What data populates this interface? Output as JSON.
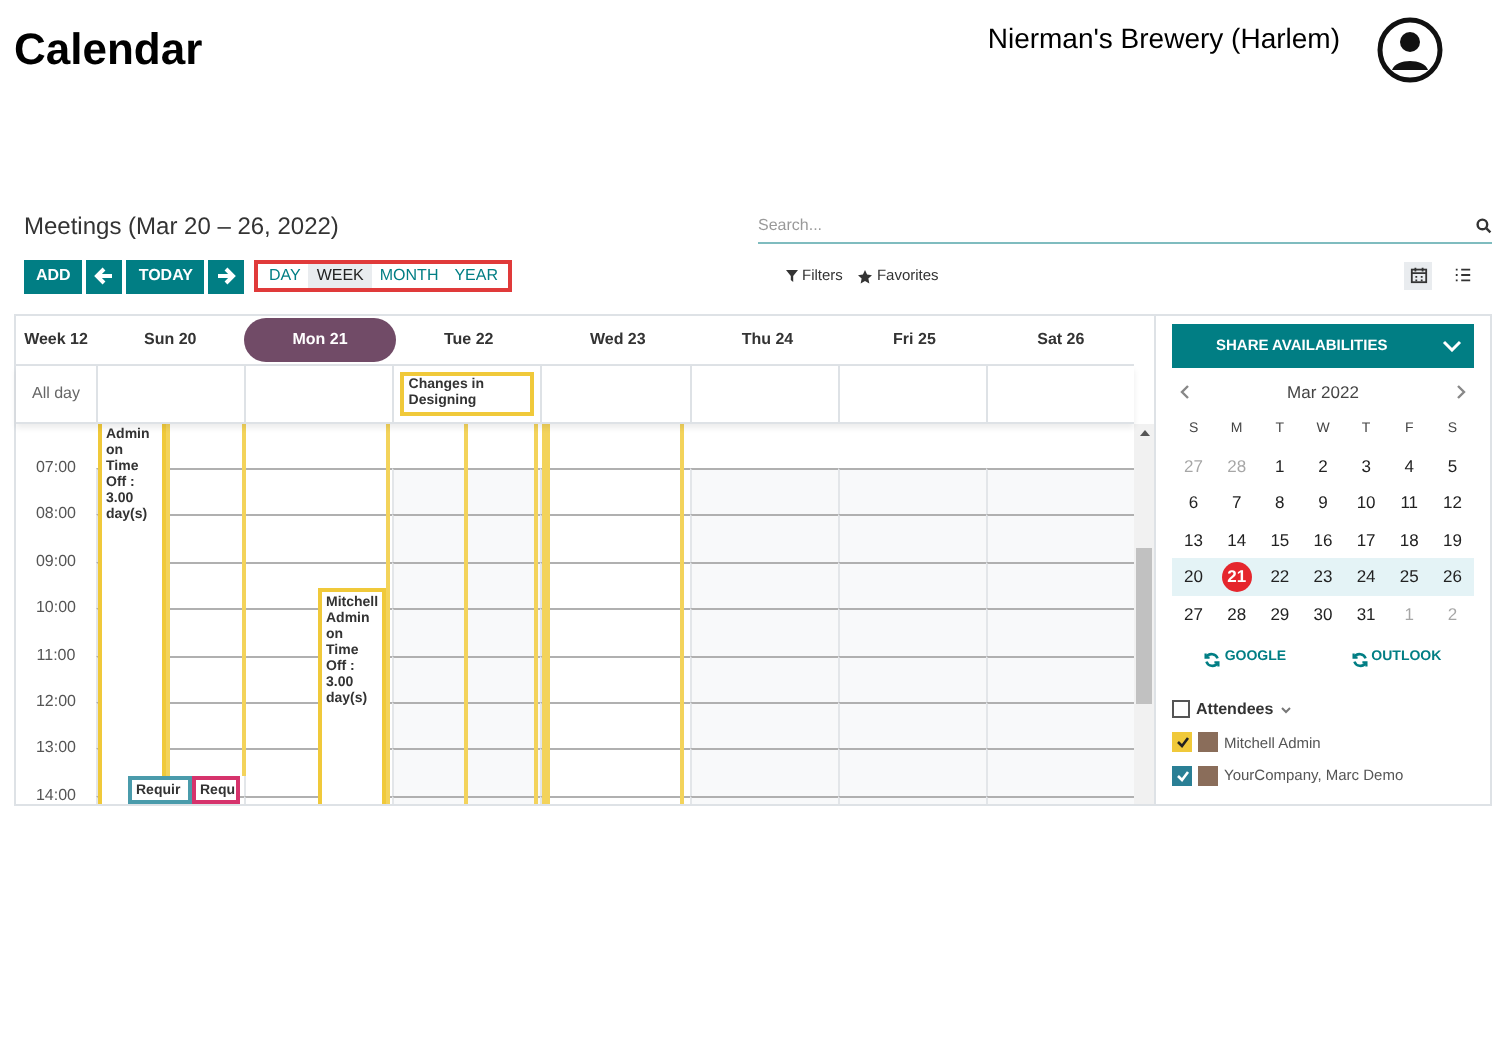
{
  "app_title": "Calendar",
  "company": "Nierman's Brewery (Harlem)",
  "view_title": "Meetings (Mar 20 – 26, 2022)",
  "search": {
    "placeholder": "Search..."
  },
  "nav_buttons": [
    {
      "kind": "text",
      "label": "ADD"
    },
    {
      "kind": "prev"
    },
    {
      "kind": "text",
      "label": "TODAY"
    },
    {
      "kind": "next"
    }
  ],
  "scales": [
    {
      "label": "DAY",
      "selected": false
    },
    {
      "label": "WEEK",
      "selected": true
    },
    {
      "label": "MONTH",
      "selected": false
    },
    {
      "label": "YEAR",
      "selected": false
    }
  ],
  "filters": [
    "Filters",
    "Favorites"
  ],
  "views": [
    {
      "kind": "calendar",
      "selected": true
    },
    {
      "kind": "list",
      "selected": false
    }
  ],
  "week_label": "Week 12",
  "days": [
    {
      "label": "Sun 20",
      "selected": false
    },
    {
      "label": "Mon 21",
      "selected": true
    },
    {
      "label": "Tue 22",
      "selected": false
    },
    {
      "label": "Wed 23",
      "selected": false
    },
    {
      "label": "Thu 24",
      "selected": false
    },
    {
      "label": "Fri 25",
      "selected": false
    },
    {
      "label": "Sat 26",
      "selected": false
    }
  ],
  "allday_label": "All day",
  "allday_events": [
    {
      "text": "Changes in Designing",
      "color": "#f0c93a"
    }
  ],
  "hours": [
    "07:00",
    "08:00",
    "09:00",
    "10:00",
    "11:00",
    "12:00",
    "13:00",
    "14:00"
  ],
  "events": [
    {
      "text": "Admin on Time Off : 3.00 day(s)",
      "color": "#f0c93a"
    },
    {
      "text": "Mitchell Admin on Time Off : 3.00 day(s)",
      "color": "#f0c93a"
    },
    {
      "text": "Requir",
      "color": "#4a9bab"
    },
    {
      "text": "Requ",
      "color": "#d6336c"
    }
  ],
  "share_button": "SHARE AVAILABILITIES",
  "mini_calendar": {
    "title": "Mar 2022",
    "weekdays": [
      "S",
      "M",
      "T",
      "W",
      "T",
      "F",
      "S"
    ],
    "weeks": [
      {
        "selected": false,
        "days": [
          {
            "label": "27",
            "muted": true,
            "today": false
          },
          {
            "label": "28",
            "muted": true,
            "today": false
          },
          {
            "label": "1",
            "muted": false,
            "today": false
          },
          {
            "label": "2",
            "muted": false,
            "today": false
          },
          {
            "label": "3",
            "muted": false,
            "today": false
          },
          {
            "label": "4",
            "muted": false,
            "today": false
          },
          {
            "label": "5",
            "muted": false,
            "today": false
          }
        ]
      },
      {
        "selected": false,
        "days": [
          {
            "label": "6",
            "muted": false,
            "today": false
          },
          {
            "label": "7",
            "muted": false,
            "today": false
          },
          {
            "label": "8",
            "muted": false,
            "today": false
          },
          {
            "label": "9",
            "muted": false,
            "today": false
          },
          {
            "label": "10",
            "muted": false,
            "today": false
          },
          {
            "label": "11",
            "muted": false,
            "today": false
          },
          {
            "label": "12",
            "muted": false,
            "today": false
          }
        ]
      },
      {
        "selected": false,
        "days": [
          {
            "label": "13",
            "muted": false,
            "today": false
          },
          {
            "label": "14",
            "muted": false,
            "today": false
          },
          {
            "label": "15",
            "muted": false,
            "today": false
          },
          {
            "label": "16",
            "muted": false,
            "today": false
          },
          {
            "label": "17",
            "muted": false,
            "today": false
          },
          {
            "label": "18",
            "muted": false,
            "today": false
          },
          {
            "label": "19",
            "muted": false,
            "today": false
          }
        ]
      },
      {
        "selected": true,
        "days": [
          {
            "label": "20",
            "muted": false,
            "today": false
          },
          {
            "label": "21",
            "muted": false,
            "today": true
          },
          {
            "label": "22",
            "muted": false,
            "today": false
          },
          {
            "label": "23",
            "muted": false,
            "today": false
          },
          {
            "label": "24",
            "muted": false,
            "today": false
          },
          {
            "label": "25",
            "muted": false,
            "today": false
          },
          {
            "label": "26",
            "muted": false,
            "today": false
          }
        ]
      },
      {
        "selected": false,
        "days": [
          {
            "label": "27",
            "muted": false,
            "today": false
          },
          {
            "label": "28",
            "muted": false,
            "today": false
          },
          {
            "label": "29",
            "muted": false,
            "today": false
          },
          {
            "label": "30",
            "muted": false,
            "today": false
          },
          {
            "label": "31",
            "muted": false,
            "today": false
          },
          {
            "label": "1",
            "muted": true,
            "today": false
          },
          {
            "label": "2",
            "muted": true,
            "today": false
          }
        ]
      }
    ]
  },
  "sync_buttons": [
    "GOOGLE",
    "OUTLOOK"
  ],
  "attendees": {
    "title": "Attendees",
    "checked": false,
    "items": [
      {
        "name": "Mitchell Admin",
        "checked": true,
        "color": "#f0c93a"
      },
      {
        "name": "YourCompany, Marc Demo",
        "checked": true,
        "color": "#2a7f95"
      }
    ]
  }
}
